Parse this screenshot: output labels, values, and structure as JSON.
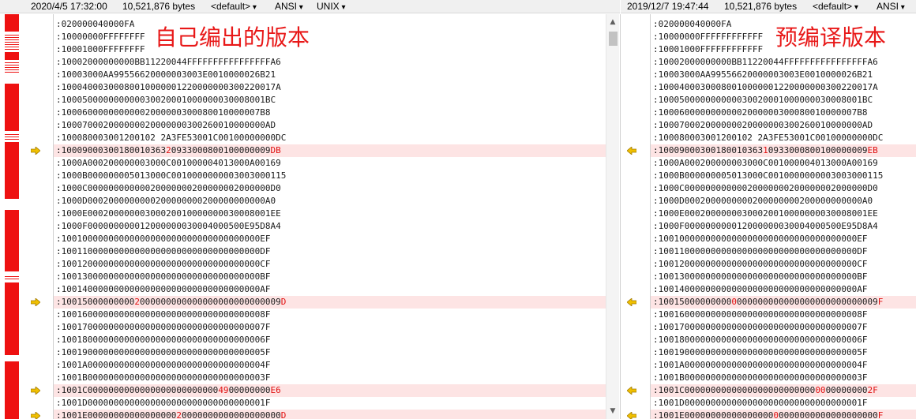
{
  "left": {
    "timestamp": "2020/4/5 17:32:00",
    "size": "10,521,876 bytes",
    "format": "<default>",
    "encoding": "ANSI",
    "line_ending": "UNIX",
    "annotation": "自己编出的版本",
    "lines": [
      {
        "t": ":020000040000FA"
      },
      {
        "t": ":10000000FFFFFFFF"
      },
      {
        "t": ":10001000FFFFFFFF"
      },
      {
        "t": ":10002000000000BB11220044FFFFFFFFFFFFFFFFA6"
      },
      {
        "t": ":10003000AA99556620000003003E0010000026B21"
      },
      {
        "t": ":10004000300080010000001220000000300220017A"
      },
      {
        "t": ":100050000000000030020001000000030008001BC"
      },
      {
        "t": ":10006000000000002000000300080010000007B8"
      },
      {
        "t": ":100070002000000020000000300260010000000AD"
      },
      {
        "t": ":100080003001200102 2A3FE53001C00100000000DC"
      },
      {
        "t": ":100090003001800103632093300080010000009DB",
        "diff": true,
        "segs": [
          [
            ":10009000300180010363",
            ""
          ],
          [
            "2",
            "hl"
          ],
          [
            "0933000800100000009",
            ""
          ],
          [
            "DB",
            "hl"
          ]
        ]
      },
      {
        "t": ":1000A000200000003000C001000004013000A00169"
      },
      {
        "t": ":1000B000000005013000C0010000000003003000115"
      },
      {
        "t": ":1000C00000000000020000000200000002000000D0"
      },
      {
        "t": ":1000D0002000000000200000000200000000000A0"
      },
      {
        "t": ":1000E00020000000300020010000000030008001EE"
      },
      {
        "t": ":1000F000000000012000000030004000500E95D8A4"
      },
      {
        "t": ":10010000000000000000000000000000000000EF"
      },
      {
        "t": ":10011000000000000000000000000000000000DF"
      },
      {
        "t": ":10012000000000000000000000000000000000CF"
      },
      {
        "t": ":10013000000000000000000000000000000000BF"
      },
      {
        "t": ":10014000000000000000000000000000000000AF"
      },
      {
        "t": ":100150000000020000000000000000000000009D",
        "diff": true,
        "segs": [
          [
            ":10015000000000",
            ""
          ],
          [
            "2",
            "hl"
          ],
          [
            "000000000000000000000000009",
            ""
          ],
          [
            "D",
            "hl"
          ]
        ]
      },
      {
        "t": ":100160000000000000000000000000000000008F"
      },
      {
        "t": ":100170000000000000000000000000000000007F"
      },
      {
        "t": ":100180000000000000000000000000000000006F"
      },
      {
        "t": ":100190000000000000000000000000000000005F"
      },
      {
        "t": ":1001A0000000000000000000000000000000004F"
      },
      {
        "t": ":1001B0000000000000000000000000000000003F"
      },
      {
        "t": ":1001C00000000000000000000000490000000E6",
        "diff": true,
        "segs": [
          [
            ":1001C0000000000000000000000000",
            ""
          ],
          [
            "49",
            "hl"
          ],
          [
            "00000000",
            ""
          ],
          [
            "E6",
            "hl"
          ]
        ]
      },
      {
        "t": ":1001D0000000000000000000000000000000001F"
      },
      {
        "t": ":1001E000000000000000020000000000000000D",
        "diff": true,
        "segs": [
          [
            ":1001E00000000000000000",
            ""
          ],
          [
            "2",
            "hl"
          ],
          [
            "0000000000000000000",
            ""
          ],
          [
            "D",
            "hl"
          ]
        ]
      }
    ]
  },
  "right": {
    "timestamp": "2019/12/7 19:47:44",
    "size": "10,521,876 bytes",
    "format": "<default>",
    "encoding": "ANSI",
    "annotation": "预编译版本",
    "lines": [
      {
        "t": ":020000040000FA"
      },
      {
        "t": ":10000000FFFFFFFFFFFF"
      },
      {
        "t": ":10001000FFFFFFFFFFFF"
      },
      {
        "t": ":10002000000000BB11220044FFFFFFFFFFFFFFFFA6"
      },
      {
        "t": ":10003000AA99556620000003003E0010000026B21"
      },
      {
        "t": ":10004000300080010000001220000000300220017A"
      },
      {
        "t": ":100050000000000030020001000000030008001BC"
      },
      {
        "t": ":10006000000000002000000300080010000007B8"
      },
      {
        "t": ":100070002000000020000000300260010000000AD"
      },
      {
        "t": ":100080003001200102 2A3FE53001C00100000000DC"
      },
      {
        "t": ":100090003001800103631093300080010000009EB",
        "diff": true,
        "segs": [
          [
            ":10009000300180010363",
            ""
          ],
          [
            "1",
            "hl"
          ],
          [
            "0933000800100000009",
            ""
          ],
          [
            "EB",
            "hl"
          ]
        ]
      },
      {
        "t": ":1000A000200000003000C001000004013000A00169"
      },
      {
        "t": ":1000B000000005013000C0010000000003003000115"
      },
      {
        "t": ":1000C00000000000020000000200000002000000D0"
      },
      {
        "t": ":1000D0002000000000200000000200000000000A0"
      },
      {
        "t": ":1000E00020000000300020010000000030008001EE"
      },
      {
        "t": ":1000F000000000012000000030004000500E95D8A4"
      },
      {
        "t": ":10010000000000000000000000000000000000EF"
      },
      {
        "t": ":10011000000000000000000000000000000000DF"
      },
      {
        "t": ":10012000000000000000000000000000000000CF"
      },
      {
        "t": ":10013000000000000000000000000000000000BF"
      },
      {
        "t": ":10014000000000000000000000000000000000AF"
      },
      {
        "t": ":100150000000000000000000000000000000009F",
        "diff": true,
        "segs": [
          [
            ":10015000000000",
            ""
          ],
          [
            "0",
            "hl"
          ],
          [
            "000000000000000000000000009",
            ""
          ],
          [
            "F",
            "hl"
          ]
        ]
      },
      {
        "t": ":100160000000000000000000000000000000008F"
      },
      {
        "t": ":100170000000000000000000000000000000007F"
      },
      {
        "t": ":100180000000000000000000000000000000006F"
      },
      {
        "t": ":100190000000000000000000000000000000005F"
      },
      {
        "t": ":1001A0000000000000000000000000000000004F"
      },
      {
        "t": ":1001B0000000000000000000000000000000003F"
      },
      {
        "t": ":1001C00000000000000000000000000000002F",
        "diff": true,
        "segs": [
          [
            ":1001C0000000000000000000000000",
            ""
          ],
          [
            "00",
            "hl"
          ],
          [
            "00000000",
            ""
          ],
          [
            "2F",
            "hl"
          ]
        ]
      },
      {
        "t": ":1001D0000000000000000000000000000000001F"
      },
      {
        "t": ":1001E000000000000000000000000000000000F",
        "diff": true,
        "segs": [
          [
            ":1001E00000000000000000",
            ""
          ],
          [
            "0",
            "hl"
          ],
          [
            "0000000000000000000",
            ""
          ],
          [
            "F",
            "hl"
          ]
        ]
      }
    ]
  },
  "colors": {
    "diff_bg": "#fde4e4",
    "diff_text": "#e01010",
    "overview": "#ee1111",
    "annotation": "#e81818",
    "arrow": "#f0c000"
  }
}
